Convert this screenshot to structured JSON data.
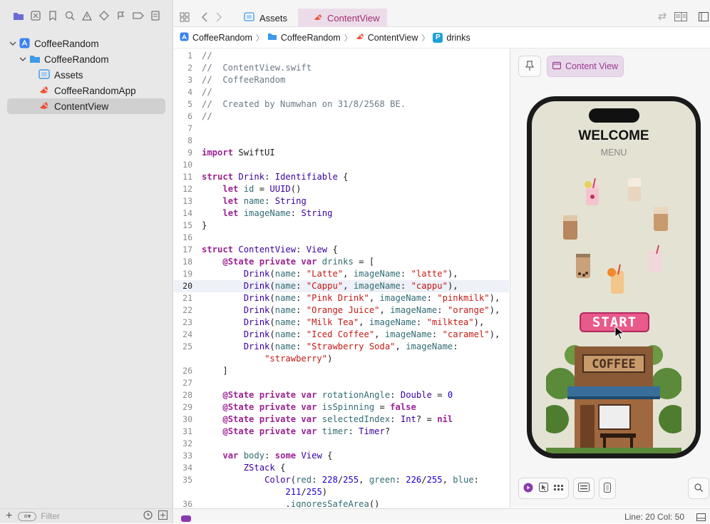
{
  "navigator": {
    "tree": [
      {
        "label": "CoffeeRandom",
        "level": 0,
        "kind": "project",
        "expanded": true
      },
      {
        "label": "CoffeeRandom",
        "level": 1,
        "kind": "folder",
        "expanded": true
      },
      {
        "label": "Assets",
        "level": 2,
        "kind": "assets"
      },
      {
        "label": "CoffeeRandomApp",
        "level": 2,
        "kind": "swift"
      },
      {
        "label": "ContentView",
        "level": 2,
        "kind": "swift",
        "selected": true
      }
    ],
    "filter_placeholder": "Filter"
  },
  "tabs": [
    {
      "label": "Assets",
      "active": false
    },
    {
      "label": "ContentView",
      "active": true
    }
  ],
  "breadcrumb": [
    "CoffeeRandom",
    "CoffeeRandom",
    "ContentView",
    "drinks"
  ],
  "breadcrumb_symbol": "P",
  "editor": {
    "current_line": 20,
    "lines": [
      {
        "n": 1,
        "html": "<span class='c'>//</span>"
      },
      {
        "n": 2,
        "html": "<span class='c'>//  ContentView.swift</span>"
      },
      {
        "n": 3,
        "html": "<span class='c'>//  CoffeeRandom</span>"
      },
      {
        "n": 4,
        "html": "<span class='c'>//</span>"
      },
      {
        "n": 5,
        "html": "<span class='c'>//  Created by Numwhan on 31/8/2568 BE.</span>"
      },
      {
        "n": 6,
        "html": "<span class='c'>//</span>"
      },
      {
        "n": 7,
        "html": ""
      },
      {
        "n": 8,
        "html": ""
      },
      {
        "n": 9,
        "html": "<span class='k'>import</span> SwiftUI"
      },
      {
        "n": 10,
        "html": ""
      },
      {
        "n": 11,
        "html": "<span class='k'>struct</span> <span class='t'>Drink</span>: <span class='t'>Identifiable</span> {"
      },
      {
        "n": 12,
        "html": "    <span class='k'>let</span> <span class='p'>id</span> = <span class='t'>UUID</span>()"
      },
      {
        "n": 13,
        "html": "    <span class='k'>let</span> <span class='p'>name</span>: <span class='t'>String</span>"
      },
      {
        "n": 14,
        "html": "    <span class='k'>let</span> <span class='p'>imageName</span>: <span class='t'>String</span>"
      },
      {
        "n": 15,
        "html": "}"
      },
      {
        "n": 16,
        "html": ""
      },
      {
        "n": 17,
        "html": "<span class='k'>struct</span> <span class='t'>ContentView</span>: <span class='t'>View</span> {"
      },
      {
        "n": 18,
        "html": "    <span class='k'>@State private var</span> <span class='p'>drinks</span> = ["
      },
      {
        "n": 19,
        "html": "        <span class='t'>Drink</span>(<span class='p'>name</span>: <span class='s'>\"Latte\"</span>, <span class='p'>imageName</span>: <span class='s'>\"latte\"</span>),"
      },
      {
        "n": 20,
        "html": "        <span class='t'>Drink</span>(<span class='p'>name</span>: <span class='s'>\"Cappu\"</span>, <span class='p'>imageName</span>: <span class='s'>\"cappu\"</span>),"
      },
      {
        "n": 21,
        "html": "        <span class='t'>Drink</span>(<span class='p'>name</span>: <span class='s'>\"Pink Drink\"</span>, <span class='p'>imageName</span>: <span class='s'>\"pinkmilk\"</span>),"
      },
      {
        "n": 22,
        "html": "        <span class='t'>Drink</span>(<span class='p'>name</span>: <span class='s'>\"Orange Juice\"</span>, <span class='p'>imageName</span>: <span class='s'>\"orange\"</span>),"
      },
      {
        "n": 23,
        "html": "        <span class='t'>Drink</span>(<span class='p'>name</span>: <span class='s'>\"Milk Tea\"</span>, <span class='p'>imageName</span>: <span class='s'>\"milktea\"</span>),"
      },
      {
        "n": 24,
        "html": "        <span class='t'>Drink</span>(<span class='p'>name</span>: <span class='s'>\"Iced Coffee\"</span>, <span class='p'>imageName</span>: <span class='s'>\"caramel\"</span>),"
      },
      {
        "n": 25,
        "html": "        <span class='t'>Drink</span>(<span class='p'>name</span>: <span class='s'>\"Strawberry Soda\"</span>, <span class='p'>imageName</span>:"
      },
      {
        "n": "",
        "html": "            <span class='s'>\"strawberry\"</span>)"
      },
      {
        "n": 26,
        "html": "    ]"
      },
      {
        "n": 27,
        "html": ""
      },
      {
        "n": 28,
        "html": "    <span class='k'>@State private var</span> <span class='p'>rotationAngle</span>: <span class='t'>Double</span> = <span class='n'>0</span>"
      },
      {
        "n": 29,
        "html": "    <span class='k'>@State private var</span> <span class='p'>isSpinning</span> = <span class='k'>false</span>"
      },
      {
        "n": 30,
        "html": "    <span class='k'>@State private var</span> <span class='p'>selectedIndex</span>: <span class='t'>Int</span>? = <span class='k'>nil</span>"
      },
      {
        "n": 31,
        "html": "    <span class='k'>@State private var</span> <span class='p'>timer</span>: <span class='t'>Timer</span>?"
      },
      {
        "n": 32,
        "html": ""
      },
      {
        "n": 33,
        "html": "    <span class='k'>var</span> <span class='p'>body</span>: <span class='k'>some</span> <span class='t'>View</span> {"
      },
      {
        "n": 34,
        "html": "        <span class='t'>ZStack</span> {"
      },
      {
        "n": 35,
        "html": "            <span class='t'>Color</span>(<span class='p'>red</span>: <span class='n'>228</span>/<span class='n'>255</span>, <span class='p'>green</span>: <span class='n'>226</span>/<span class='n'>255</span>, <span class='p'>blue</span>:"
      },
      {
        "n": "",
        "html": "                <span class='n'>211</span>/<span class='n'>255</span>)"
      },
      {
        "n": 36,
        "html": "                .<span class='p'>ignoresSafeArea</span>()"
      }
    ]
  },
  "canvas": {
    "preview_label": "Content View",
    "app": {
      "title": "WELCOME",
      "subtitle": "MENU",
      "start_label": "START",
      "shop_sign": "COFFEE"
    }
  },
  "statusbar": {
    "position": "Line: 20  Col: 50"
  }
}
